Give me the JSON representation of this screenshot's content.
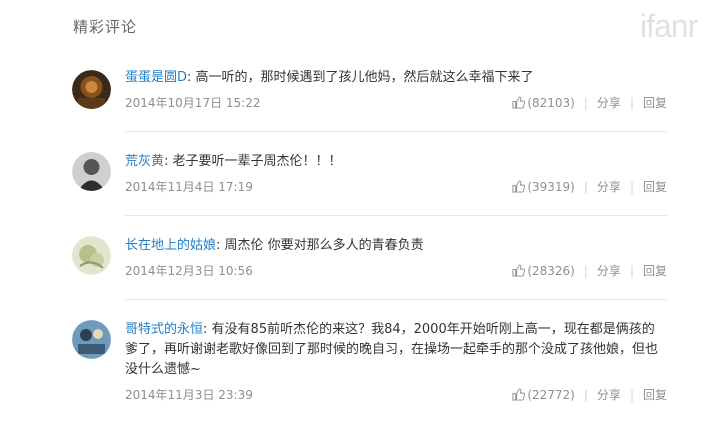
{
  "section": {
    "title": "精彩评论"
  },
  "watermark": "ifanr",
  "comments": [
    {
      "username": "蛋蛋是圆D",
      "lines": [
        "高一听的，那时候遇到了孩儿他妈，然后就这么幸福下来了"
      ],
      "date": "2014年10月17日 15:22",
      "likes": "(82103)",
      "share": "分享",
      "reply": "回复",
      "avatar_colors": [
        "#8a4f1a",
        "#3a2a1a"
      ]
    },
    {
      "username": "荒灰黄",
      "lines": [
        "老子要听一辈子周杰伦！！！"
      ],
      "date": "2014年11月4日 17:19",
      "likes": "(39319)",
      "share": "分享",
      "reply": "回复",
      "avatar_colors": [
        "#b8b8b8",
        "#3c3c3c"
      ]
    },
    {
      "username": "长在地上的姑娘",
      "lines": [
        "周杰伦 你要对那么多人的青春负责"
      ],
      "date": "2014年12月3日 10:56",
      "likes": "(28326)",
      "share": "分享",
      "reply": "回复",
      "avatar_colors": [
        "#dfe3c2",
        "#a9b47a"
      ]
    },
    {
      "username": "哥特式的永恒",
      "lines": [
        "有没有85前听杰伦的来这？我84，2000年开始听刚上高一，现在都是俩孩的",
        "爹了，再听谢谢老歌好像回到了那时候的晚自习，在操场一起牵手的那个没成了孩他娘，但也",
        "没什么遗憾~"
      ],
      "date": "2014年11月3日 23:39",
      "likes": "(22772)",
      "share": "分享",
      "reply": "回复",
      "avatar_colors": [
        "#5f8fb0",
        "#2b3f55"
      ]
    }
  ]
}
